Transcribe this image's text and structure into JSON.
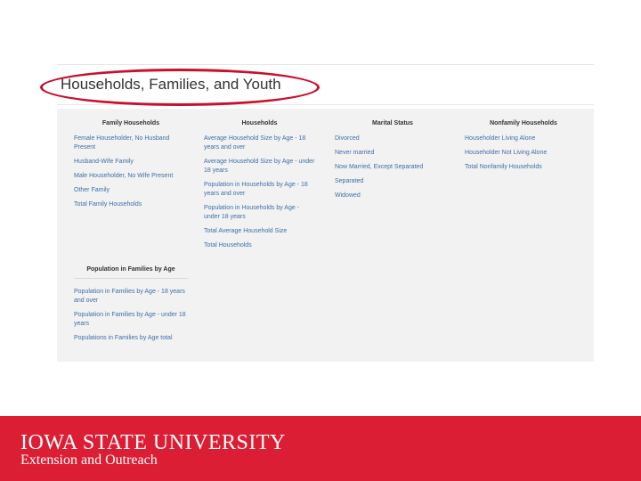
{
  "page_title": "Households, Families, and Youth",
  "columns": [
    {
      "heading": "Family Households",
      "items": [
        "Female Householder, No Husband Present",
        "Husband-Wife Family",
        "Male Householder, No Wife Present",
        "Other Family",
        "Total Family Households"
      ]
    },
    {
      "heading": "Households",
      "items": [
        "Average Household Size by Age - 18 years and over",
        "Average Household Size by Age - under 18 years",
        "Population in Households by Age - 18 years and over",
        "Population in Households by Age - under 18 years",
        "Total Average Household Size",
        "Total Households"
      ]
    },
    {
      "heading": "Marital Status",
      "items": [
        "Divorced",
        "Never married",
        "Now Married, Except Separated",
        "Separated",
        "Widowed"
      ]
    },
    {
      "heading": "Nonfamily Households",
      "items": [
        "Householder Living Alone",
        "Householder Not Living Alone",
        "Total Nonfamily Households"
      ]
    }
  ],
  "population_group": {
    "heading": "Population in Families by Age",
    "items": [
      "Population in Families by Age - 18 years and over",
      "Population in Families by Age - under 18 years",
      "Populations in Families by Age total"
    ]
  },
  "footer": {
    "line1": "IOWA STATE UNIVERSITY",
    "line2": "Extension and Outreach"
  },
  "colors": {
    "accent": "#c8102e",
    "footer_background": "#dc1e35",
    "link": "#3f6ea6"
  }
}
